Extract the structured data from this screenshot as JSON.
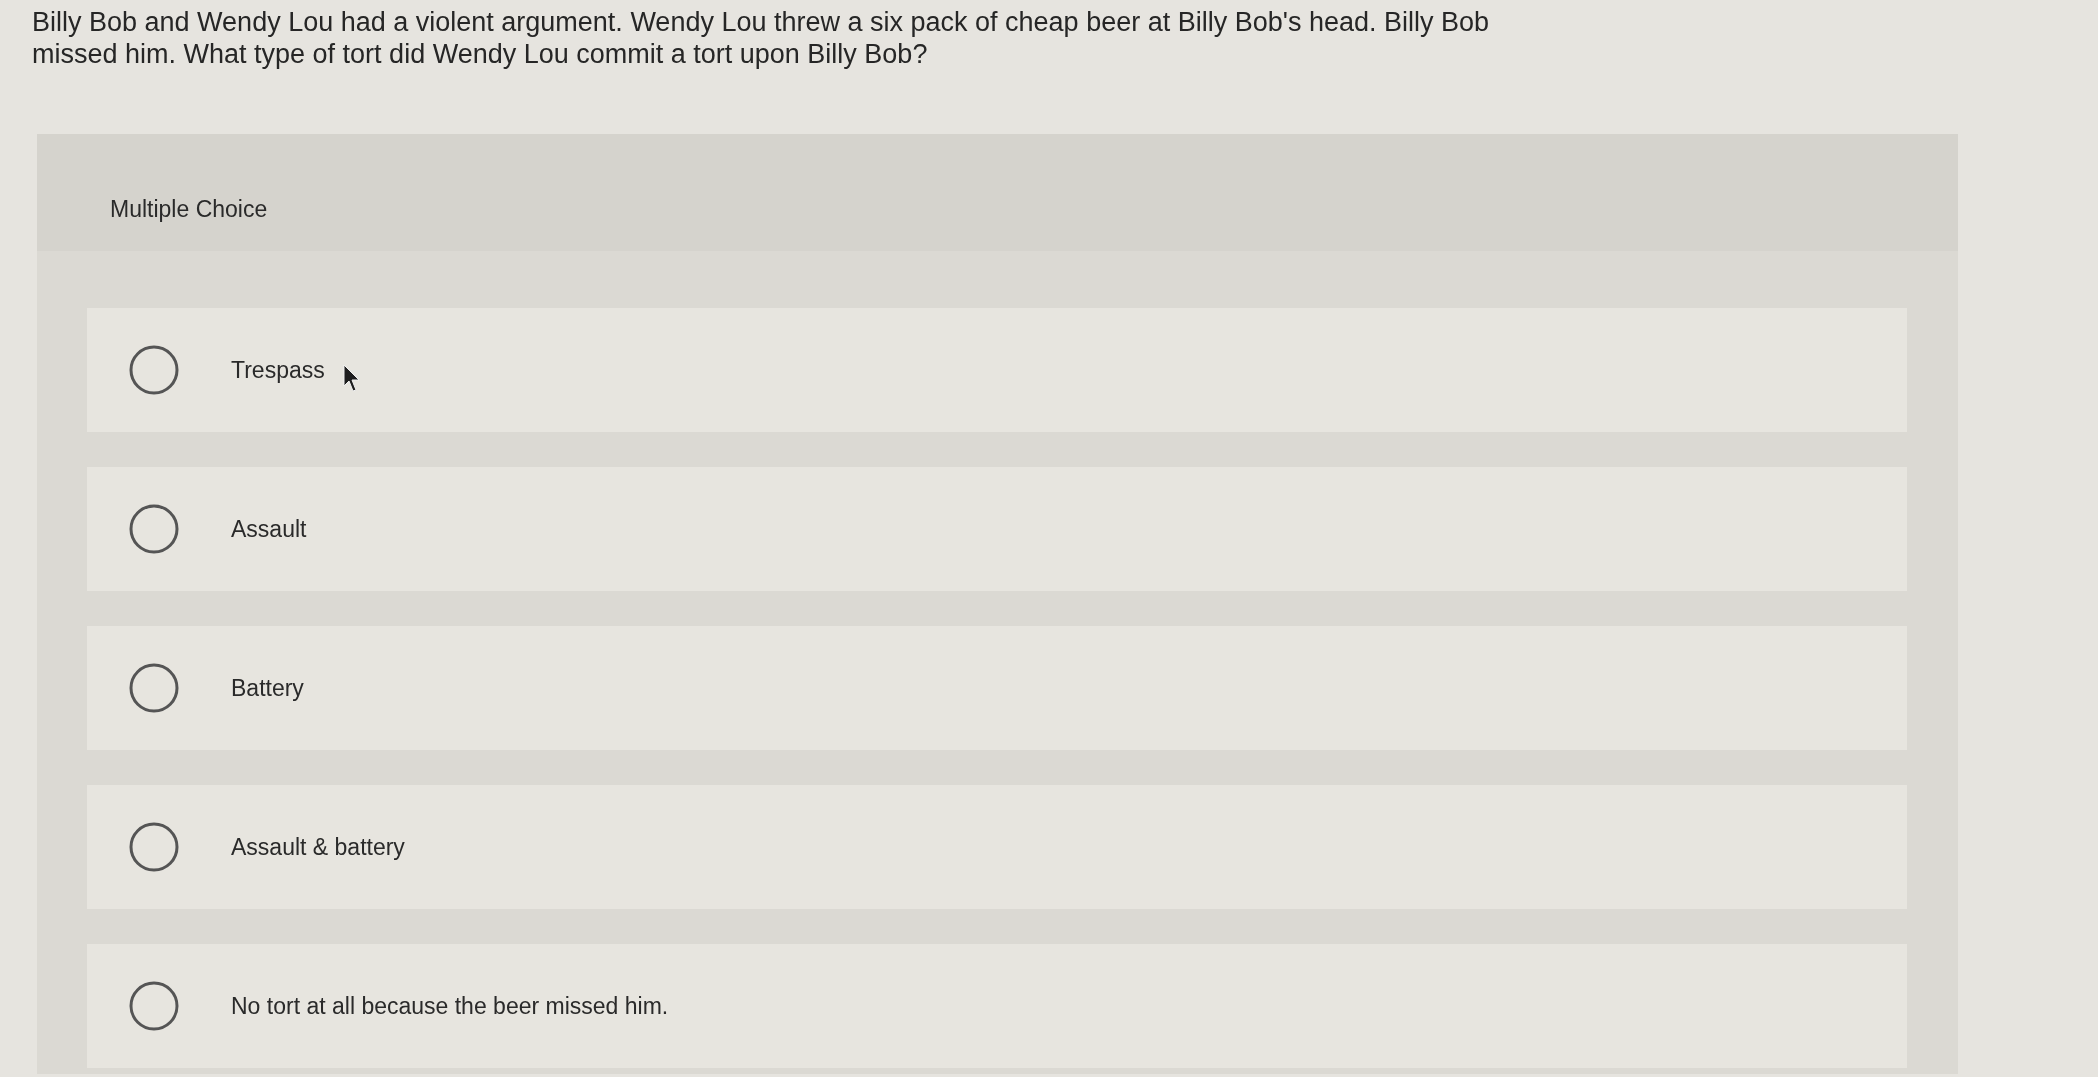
{
  "question": {
    "lines": [
      "Billy Bob and Wendy Lou had a violent argument. Wendy Lou threw a six pack of cheap beer at Billy Bob's head. Billy Bob",
      "missed him. What type of tort did Wendy Lou commit a tort upon Billy Bob?"
    ]
  },
  "panel": {
    "title": "Multiple Choice",
    "options": [
      {
        "label": "Trespass",
        "selected": false
      },
      {
        "label": "Assault",
        "selected": false
      },
      {
        "label": "Battery",
        "selected": false
      },
      {
        "label": "Assault & battery",
        "selected": false
      },
      {
        "label": "No tort at all because the beer missed him.",
        "selected": false
      }
    ]
  }
}
